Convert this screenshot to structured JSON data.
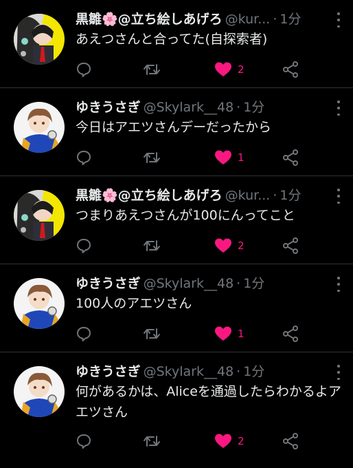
{
  "colors": {
    "background": "#000000",
    "text": "#e7e9ea",
    "muted": "#71767b",
    "like": "#f91880",
    "divider": "#2f3336"
  },
  "tweets": [
    {
      "name": "黒雛🌸@立ち絵しあげろ",
      "handle": "@kur...",
      "separator": "·",
      "time": "1分",
      "text": "あえつさんと合ってた(自探索者)",
      "likes": "2",
      "avatar": "kurohina"
    },
    {
      "name": "ゆきうさぎ",
      "handle": "@Skylark__48",
      "separator": "·",
      "time": "1分",
      "text": "今日はアエツさんデーだったから",
      "likes": "1",
      "avatar": "yukiusagi"
    },
    {
      "name": "黒雛🌸@立ち絵しあげろ",
      "handle": "@kur...",
      "separator": "·",
      "time": "1分",
      "text": "つまりあえつさんが100にんってこと",
      "likes": "2",
      "avatar": "kurohina"
    },
    {
      "name": "ゆきうさぎ",
      "handle": "@Skylark__48",
      "separator": "·",
      "time": "1分",
      "text": "100人のアエツさん",
      "likes": "1",
      "avatar": "yukiusagi"
    },
    {
      "name": "ゆきうさぎ",
      "handle": "@Skylark__48",
      "separator": "·",
      "time": "1分",
      "text": "何があるかは、Aliceを通過したらわかるよアエツさん",
      "likes": "2",
      "avatar": "yukiusagi"
    }
  ],
  "icons": {
    "reply": "reply-icon",
    "retweet": "retweet-icon",
    "like": "heart-icon",
    "share": "share-icon",
    "more": "more-icon"
  }
}
